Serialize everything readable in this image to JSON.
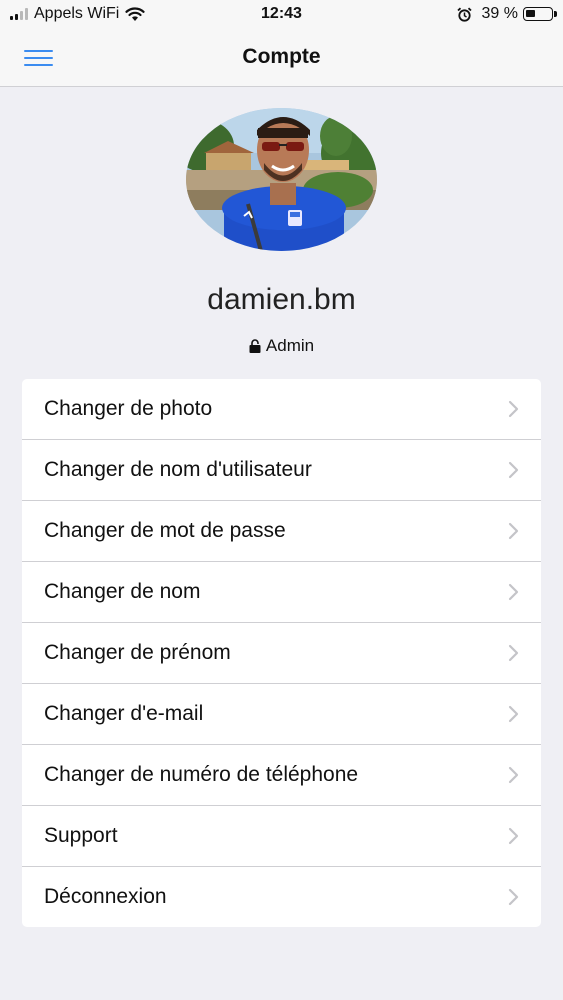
{
  "status_bar": {
    "carrier": "Appels WiFi",
    "time": "12:43",
    "battery_text": "39 %",
    "battery_level": 0.39
  },
  "nav": {
    "title": "Compte",
    "menu_icon": "hamburger-menu-icon",
    "accent_color": "#3b8cf0"
  },
  "profile": {
    "username": "damien.bm",
    "role": "Admin",
    "role_icon": "lock-icon"
  },
  "menu": {
    "items": [
      {
        "label": "Changer de photo"
      },
      {
        "label": "Changer de nom d'utilisateur"
      },
      {
        "label": "Changer de mot de passe"
      },
      {
        "label": "Changer de nom"
      },
      {
        "label": "Changer de prénom"
      },
      {
        "label": "Changer d'e-mail"
      },
      {
        "label": "Changer de numéro de téléphone"
      },
      {
        "label": "Support"
      },
      {
        "label": "Déconnexion"
      }
    ],
    "item_icon": "chevron-right-icon"
  }
}
